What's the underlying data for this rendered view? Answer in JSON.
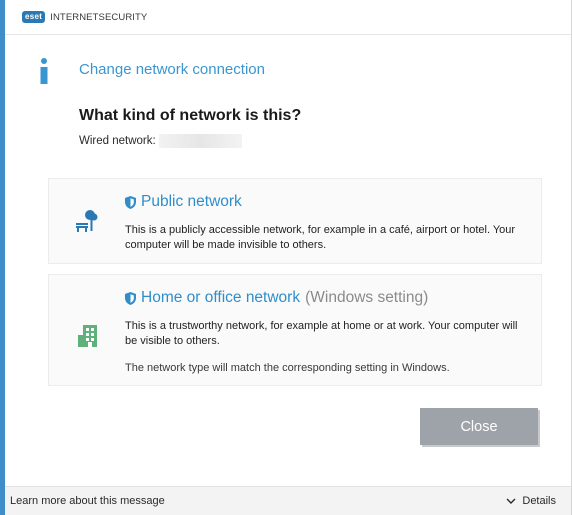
{
  "app": {
    "logo_badge": "eset",
    "product_name": "INTERNETSECURITY"
  },
  "header": {
    "icon": "info-icon",
    "title": "Change network connection"
  },
  "question": "What kind of network is this?",
  "wired": {
    "label": "Wired network:"
  },
  "options": [
    {
      "icon": "bench-tree-icon",
      "title": "Public network",
      "description": "This is a publicly accessible network, for example in a café, airport or hotel. Your computer will be made invisible to others."
    },
    {
      "icon": "office-building-icon",
      "title": "Home or office network",
      "title_suffix": "(Windows setting)",
      "description": "This is a trustworthy network, for example at home or at work. Your computer will be visible to others.",
      "note": "The network type will match the corresponding setting in Windows."
    }
  ],
  "buttons": {
    "close": "Close"
  },
  "footer": {
    "learn_more": "Learn more about this message",
    "details": "Details"
  },
  "colors": {
    "accent": "#3f8ec9",
    "link_blue": "#2f8ec9",
    "icon_blue": "#2a79b5",
    "icon_green": "#5fb07b",
    "button_gray": "#9da3a8"
  }
}
